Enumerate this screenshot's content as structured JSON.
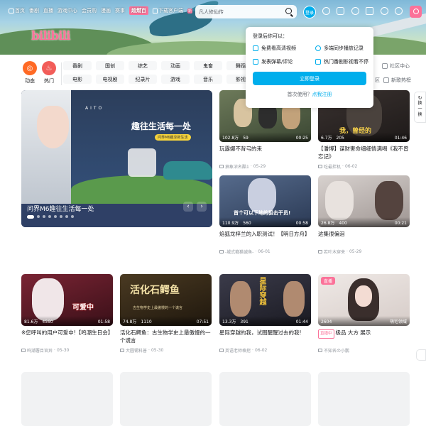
{
  "topnav": {
    "items": [
      "首页",
      "番剧",
      "直播",
      "游戏中心",
      "会员购",
      "漫画",
      "赛事"
    ],
    "manga_badge": "超燃百",
    "download": "下载客户端",
    "new_badge": "新"
  },
  "search": {
    "placeholder": "凡人修仙传"
  },
  "header": {
    "login": "登录",
    "logo": "bilibili"
  },
  "channels": {
    "dynamic": "动态",
    "hot": "热门",
    "row1": [
      "番剧",
      "国创",
      "综艺",
      "动画",
      "鬼畜",
      "舞蹈"
    ],
    "row2": [
      "电影",
      "电视剧",
      "纪录片",
      "游戏",
      "音乐",
      "影视"
    ],
    "community": "社区中心",
    "new_hot": "新歌热榜",
    "cut_off": "区"
  },
  "login_popup": {
    "title": "登录后你可以：",
    "features": [
      "免费看高清视频",
      "多端同步播放记录",
      "发表弹幕/评论",
      "热门番剧影视看不停"
    ],
    "button": "立即登录",
    "first_use": "首次使用？",
    "register": "点我注册"
  },
  "carousel": {
    "title": "问界M6趣往生活每一处",
    "slogan": "趣往生活每一处",
    "tag": "问界M6趣享新生活",
    "brand": "AITO",
    "prev": "‹",
    "next": "›"
  },
  "side": {
    "refresh_label": "换一换"
  },
  "cards": [
    {
      "views": "102.8万",
      "danmaku": "59",
      "duration": "00:25",
      "title": "玩露娜不背弓的来",
      "uploader": "抽象浓名酷1",
      "date": "05-29"
    },
    {
      "views": "6.7万",
      "danmaku": "205",
      "duration": "01:46",
      "title": "【潘博】谋财害命细细情满喝《我不曾忘记》",
      "uploader": "吃最拌机",
      "date": "06-02",
      "overlay": "我，曾经的"
    },
    {
      "views": "110.9万",
      "danmaku": "560",
      "duration": "00:58",
      "title": "焰狐龙梓兰的入职测试！【明日方舟】",
      "uploader": "-城式箍猫诚鱼-",
      "date": "06-01",
      "overlay": "首个可以下地的狙击干员!"
    },
    {
      "views": "26.8万",
      "danmaku": "400",
      "duration": "00:21",
      "title": "这集很偏泪",
      "uploader": "若叶木穿来",
      "date": "05-29"
    },
    {
      "views": "81.6万",
      "danmaku": "4560",
      "duration": "01:58",
      "title": "※您呼叫的用户可爱中!【鸣潮生日会】",
      "uploader": "鸣潮署目官异",
      "date": "05-30",
      "overlay": "可爱中"
    },
    {
      "views": "74.8万",
      "danmaku": "1110",
      "duration": "07:51",
      "title": "活化石鳄鱼：古生物学史上最傲慢的一个谎言",
      "uploader": "大圆锡科普",
      "date": "05-30",
      "overlay": "活化石鳄鱼",
      "overlay_sub": "古生物学史上最傲慢的一个谎言"
    },
    {
      "views": "13.3万",
      "danmaku": "391",
      "duration": "01:44",
      "title": "星际穿越的我，试图醒醒过去的我!",
      "uploader": "英语老师格挖",
      "date": "06-02",
      "overlay": "星际穿越"
    },
    {
      "live": "直播",
      "viewers": "2604",
      "area": "萌宅领域",
      "live_tag": "直播中",
      "title": "极品 大方 展示",
      "uploader": "不知名の小鹏"
    }
  ]
}
